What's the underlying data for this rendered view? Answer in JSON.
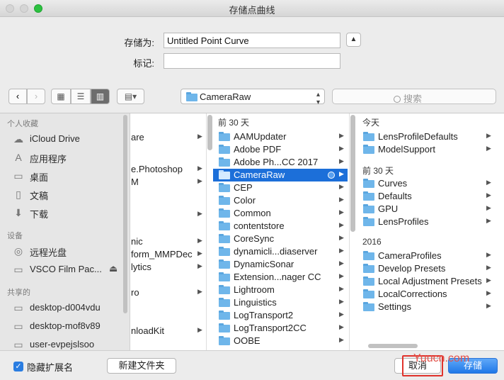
{
  "window": {
    "title": "存储点曲线"
  },
  "form": {
    "save_as_label": "存储为:",
    "save_as_value": "Untitled Point Curve",
    "tags_label": "标记:",
    "tags_value": "",
    "expand_icon": "chevron-up-icon"
  },
  "toolbar": {
    "back": "‹",
    "forward": "›",
    "view_icon": "▦",
    "view_list": "☰",
    "view_column": "▥",
    "view_gallery": "▤▾",
    "path": "CameraRaw",
    "search_placeholder": "搜索"
  },
  "sidebar": {
    "favorites_header": "个人收藏",
    "favorites": [
      {
        "label": "iCloud Drive",
        "icon": "☁"
      },
      {
        "label": "应用程序",
        "icon": "A"
      },
      {
        "label": "桌面",
        "icon": "▭"
      },
      {
        "label": "文稿",
        "icon": "▯"
      },
      {
        "label": "下载",
        "icon": "⬇"
      }
    ],
    "devices_header": "设备",
    "devices": [
      {
        "label": "远程光盘",
        "icon": "◎"
      },
      {
        "label": "VSCO Film Pac...",
        "icon": "▭",
        "eject": "⏏"
      }
    ],
    "shared_header": "共享的",
    "shared": [
      {
        "label": "desktop-d004vdu",
        "icon": "▭"
      },
      {
        "label": "desktop-mof8v89",
        "icon": "▭"
      },
      {
        "label": "user-evpejslsoo",
        "icon": "▭"
      }
    ]
  },
  "column1": {
    "items": [
      "are",
      "e.Photoshop",
      "M",
      "",
      "nic",
      "form_MMPDec",
      "lytics",
      "ro",
      "nloadKit"
    ]
  },
  "column2": {
    "header": "前 30 天",
    "items": [
      "AAMUpdater",
      "Adobe PDF",
      "Adobe Ph...CC 2017",
      "CameraRaw",
      "CEP",
      "Color",
      "Common",
      "contentstore",
      "CoreSync",
      "dynamicli...diaserver",
      "DynamicSonar",
      "Extension...nager CC",
      "Lightroom",
      "Linguistics",
      "LogTransport2",
      "LogTransport2CC",
      "OOBE"
    ],
    "selected": "CameraRaw"
  },
  "column3": {
    "today_header": "今天",
    "today": [
      "LensProfileDefaults",
      "ModelSupport"
    ],
    "last30_header": "前 30 天",
    "last30": [
      "Curves",
      "Defaults",
      "GPU",
      "LensProfiles"
    ],
    "y2016_header": "2016",
    "y2016": [
      "CameraProfiles",
      "Develop Presets",
      "Local Adjustment Presets",
      "LocalCorrections",
      "Settings"
    ]
  },
  "bottom": {
    "hide_ext_label": "隐藏扩展名",
    "checkbox_mark": "✓",
    "new_folder": "新建文件夹",
    "cancel": "取消",
    "save": "存储"
  },
  "watermark": {
    "text": "Yuucn.com"
  },
  "arrow": "▶",
  "colors": {
    "accent": "#1c6fd9",
    "folder": "#6fb6ea",
    "highlight": "#e0332c"
  }
}
